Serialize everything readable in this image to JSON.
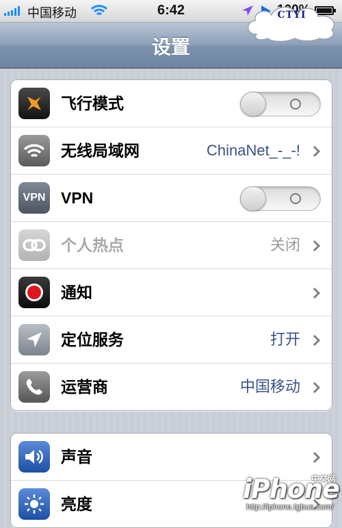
{
  "status_bar": {
    "carrier": "中国移动",
    "time": "6:42",
    "battery": "100%"
  },
  "nav": {
    "title": "设置",
    "badge": "CTYI"
  },
  "group1": [
    {
      "label": "飞行模式",
      "icon": "airplane-icon",
      "control": "toggle",
      "value": ""
    },
    {
      "label": "无线局域网",
      "icon": "wifi-icon",
      "control": "disclosure",
      "value": "ChinaNet_-_-!"
    },
    {
      "label": "VPN",
      "icon": "vpn-icon",
      "control": "toggle",
      "value": ""
    },
    {
      "label": "个人热点",
      "icon": "hotspot-icon",
      "control": "disclosure",
      "value": "关闭"
    },
    {
      "label": "通知",
      "icon": "notification-icon",
      "control": "disclosure",
      "value": ""
    },
    {
      "label": "定位服务",
      "icon": "location-icon",
      "control": "disclosure",
      "value": "打开"
    },
    {
      "label": "运营商",
      "icon": "phone-icon",
      "control": "disclosure",
      "value": "中国移动"
    }
  ],
  "group2": [
    {
      "label": "声音",
      "icon": "speaker-icon",
      "control": "disclosure",
      "value": ""
    },
    {
      "label": "亮度",
      "icon": "brightness-icon",
      "control": "disclosure",
      "value": ""
    }
  ],
  "icons": {
    "vpn_text": "VPN"
  },
  "watermark": {
    "logo": "iPhone",
    "cn": "中文网",
    "url": "http://iphone.tgbus.com/"
  },
  "colors": {
    "value_blue": "#385487",
    "nav_bar": "#7e93ad"
  }
}
